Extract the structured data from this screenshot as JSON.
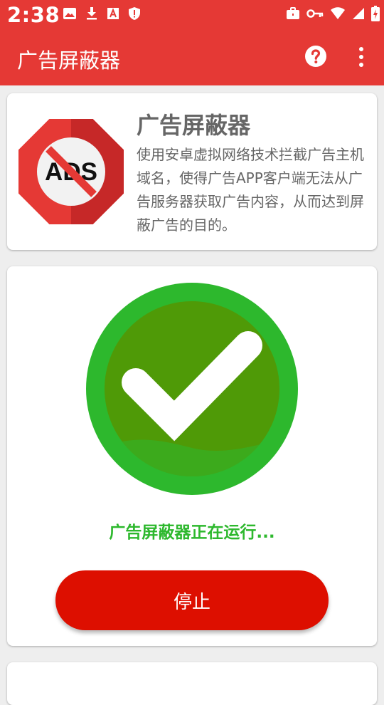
{
  "status_bar": {
    "time": "2:38",
    "left_icons": [
      "image-icon",
      "download-icon",
      "font-icon",
      "shield-icon"
    ],
    "right_icons": [
      "briefcase-icon",
      "vpn-key-icon",
      "wifi-icon",
      "signal-icon",
      "battery-charging-icon"
    ]
  },
  "app_bar": {
    "title": "广告屏蔽器",
    "help_icon": "help-circle-icon",
    "more_icon": "more-vert-icon"
  },
  "info_card": {
    "logo_text": "ADS",
    "title": "广告屏蔽器",
    "description": "使用安卓虚拟网络技术拦截广告主机域名，使得广告APP客户端无法从广告服务器获取广告内容，从而达到屏蔽广告的目的。"
  },
  "status_card": {
    "icon": "check-circle-icon",
    "status_text": "广告屏蔽器正在运行...",
    "stop_label": "停止"
  },
  "colors": {
    "primary": "#e53935",
    "success": "#2db82d",
    "success_dark": "#4f9a07",
    "stop_button": "#dd0f00"
  }
}
